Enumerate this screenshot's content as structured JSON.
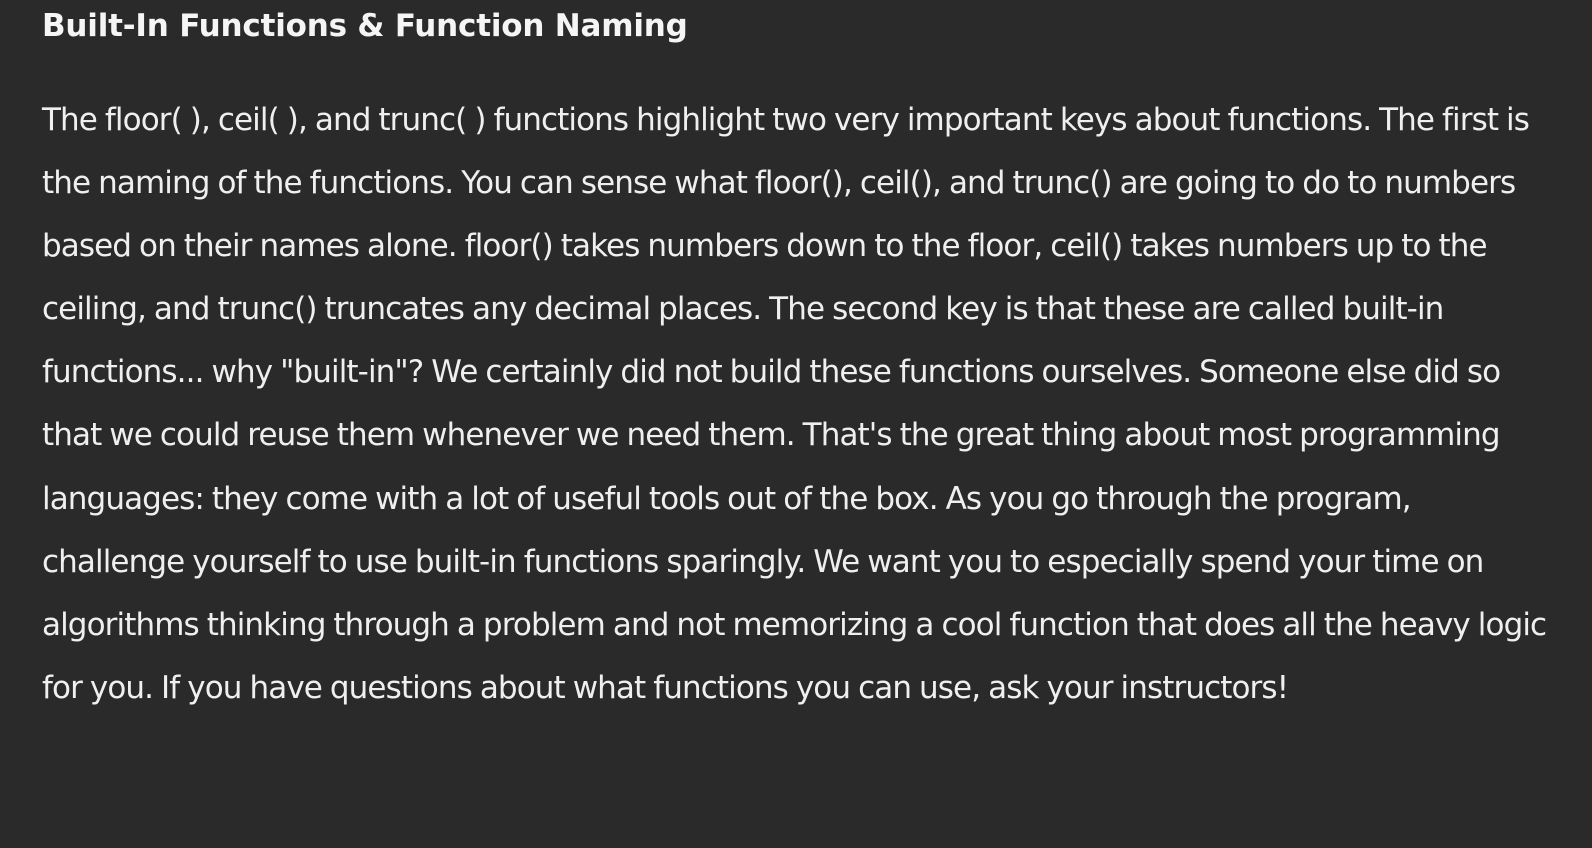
{
  "section": {
    "title": "Built-In Functions & Function Naming",
    "paragraph": "The floor( ), ceil( ), and trunc( ) functions highlight two very important keys about functions. The first is the naming of the functions. You can sense what floor(), ceil(), and trunc() are going to do to numbers based on their names alone. floor() takes numbers down to the floor, ceil() takes numbers up to the ceiling, and trunc() truncates any decimal places. The second key is that these are called built-in functions... why \"built-in\"? We certainly did not build these functions ourselves. Someone else did so that we could reuse them whenever we need them. That's the great thing about most programming languages: they come with a lot of useful tools out of the box. As you go through the program, challenge yourself to use built-in functions sparingly. We want you to especially spend your time on algorithms thinking through a problem and not memorizing a cool function that does all the heavy logic for you. If you have questions about what functions you can use, ask your instructors!"
  },
  "colors": {
    "background": "#2a2a2a",
    "text": "#efefef"
  }
}
